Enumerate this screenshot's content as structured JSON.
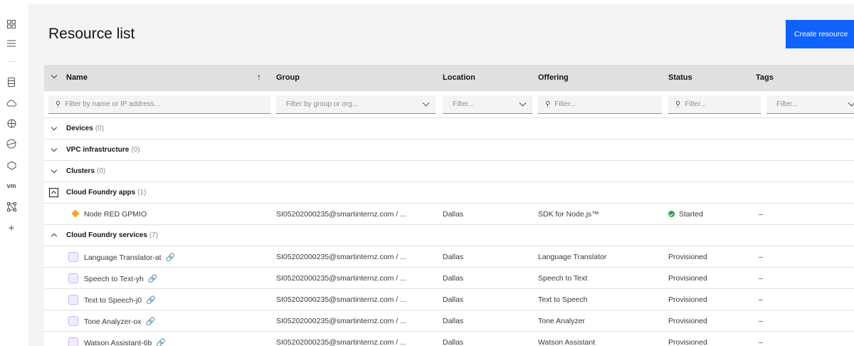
{
  "page": {
    "title": "Resource list",
    "create_button": "Create resource"
  },
  "table": {
    "columns": [
      {
        "label": "Name"
      },
      {
        "label": "Group"
      },
      {
        "label": "Location"
      },
      {
        "label": "Offering"
      },
      {
        "label": "Status"
      },
      {
        "label": "Tags"
      }
    ],
    "sort_indicator": "↑",
    "filters": {
      "name_placeholder": "Filter by name or IP address...",
      "group_placeholder": "Filter by group or org...",
      "location_placeholder": "Filter...",
      "offering_placeholder": "Filter...",
      "status_placeholder": "Filter...",
      "tags_placeholder": "Filter..."
    },
    "groups": [
      {
        "name": "Devices",
        "count": "(0)",
        "expanded": false
      },
      {
        "name": "VPC infrastructure",
        "count": "(0)",
        "expanded": false
      },
      {
        "name": "Clusters",
        "count": "(0)",
        "expanded": false
      },
      {
        "name": "Cloud Foundry apps",
        "count": "(1)",
        "expanded": true
      },
      {
        "name": "Cloud Foundry services",
        "count": "(7)",
        "expanded": true
      }
    ],
    "app_rows": [
      {
        "name": "Node RED GPMIO",
        "group": "SI05202000235@smartinternz.com / ...",
        "location": "Dallas",
        "offering": "SDK for Node.js™",
        "status": "Started",
        "tags": "–"
      }
    ],
    "service_rows": [
      {
        "name": "Language Translator-at",
        "group": "SI05202000235@smartinternz.com / ...",
        "location": "Dallas",
        "offering": "Language Translator",
        "status": "Provisioned",
        "tags": "–"
      },
      {
        "name": "Speech to Text-yh",
        "group": "SI05202000235@smartinternz.com / ...",
        "location": "Dallas",
        "offering": "Speech to Text",
        "status": "Provisioned",
        "tags": "–"
      },
      {
        "name": "Text to Speech-j0",
        "group": "SI05202000235@smartinternz.com / ...",
        "location": "Dallas",
        "offering": "Text to Speech",
        "status": "Provisioned",
        "tags": "–"
      },
      {
        "name": "Tone Analyzer-ox",
        "group": "SI05202000235@smartinternz.com / ...",
        "location": "Dallas",
        "offering": "Tone Analyzer",
        "status": "Provisioned",
        "tags": "–"
      },
      {
        "name": "Watson Assistant-6b",
        "group": "SI05202000235@smartinternz.com / ...",
        "location": "Dallas",
        "offering": "Watson Assistant",
        "status": "Provisioned",
        "tags": "–"
      }
    ]
  },
  "sidebar": {
    "vm_label": "vm",
    "add_label": "+"
  },
  "colors": {
    "primary": "#0f62fe",
    "status_started": "#24a148",
    "service_icon": "#c9b3f7",
    "app_icon": "#f5a623"
  }
}
